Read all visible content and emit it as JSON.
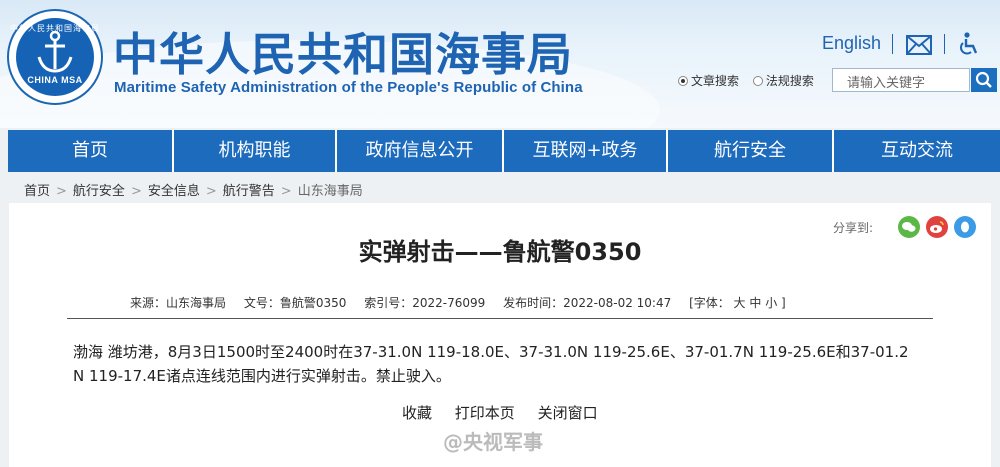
{
  "header": {
    "logo_top_text": "中华人民共和国海事局",
    "logo_bottom_text": "CHINA MSA",
    "title_cn": "中华人民共和国海事局",
    "title_en": "Maritime Safety Administration of the People's Republic of China",
    "lang_link": "English",
    "search_options": [
      "文章搜索",
      "法规搜索"
    ],
    "search_selected": "文章搜索",
    "search_placeholder": "请输入关键字"
  },
  "nav": {
    "items": [
      "首页",
      "机构职能",
      "政府信息公开",
      "互联网+政务",
      "航行安全",
      "互动交流"
    ]
  },
  "breadcrumb": [
    "首页",
    "航行安全",
    "安全信息",
    "航行警告",
    "山东海事局"
  ],
  "article": {
    "share_label": "分享到:",
    "title": "实弹射击——鲁航警0350",
    "meta": {
      "source": "来源：山东海事局",
      "doc_no": "文号：鲁航警0350",
      "index_no": "索引号：2022-76099",
      "publish_time": "发布时间：2022-08-02 10:47",
      "font_size": "[字体： 大  中  小 ]"
    },
    "body_line1": "渤海 潍坊港，8月3日1500时至2400时在37-31.0N 119-18.0E、37-31.0N 119-25.6E、37-01.7N 119-25.6E和37-01.2",
    "body_line2": "N 119-17.4E诸点连线范围内进行实弹射击。禁止驶入。",
    "actions": [
      "收藏",
      "打印本页",
      "关闭窗口"
    ]
  },
  "watermark": "@央视军事",
  "colors": {
    "brand_blue": "#1d6bbd",
    "wechat_green": "#5bb846",
    "weibo_red": "#e0433f",
    "qq_blue": "#3b9be6"
  }
}
